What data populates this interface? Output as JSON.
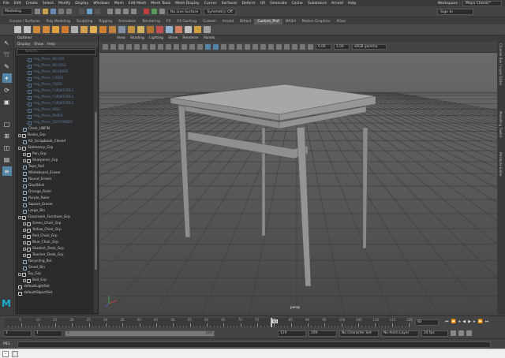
{
  "menubar": {
    "items": [
      "File",
      "Edit",
      "Create",
      "Select",
      "Modify",
      "Display",
      "Windows",
      "Mesh",
      "Edit Mesh",
      "Mesh Tools",
      "Mesh Display",
      "Curves",
      "Surfaces",
      "Deform",
      "UV",
      "Generate",
      "Cache",
      "Substance",
      "Arnold",
      "Help"
    ],
    "workspace_label": "Workspace :",
    "workspace_value": "Maya Classic*"
  },
  "statusline": {
    "mode": "Modeling",
    "live_surface": "No Live Surface",
    "symmetry": "Symmetry: Off",
    "sign_in": "Sign In"
  },
  "shelf": {
    "tabs": [
      "Curves / Surfaces",
      "Poly Modeling",
      "Sculpting",
      "Rigging",
      "Animation",
      "Rendering",
      "FX",
      "FX Caching",
      "Custom",
      "Arnold",
      "Bifrost",
      "Custom_Prof",
      "MASH",
      "Motion Graphics",
      "XGen"
    ],
    "active_tab": "Custom_Prof",
    "icon_colors": [
      "#c0c0c0",
      "#c0c0c0",
      "#d08a3a",
      "#d08a3a",
      "#e0a040",
      "#d07a30",
      "#b0b0b0",
      "#d0a050",
      "#e0b050",
      "#d08030",
      "#c08040",
      "#8090a0",
      "#c09040",
      "#d0b060",
      "#b07030",
      "#c05050",
      "#90b0d0",
      "#d08060",
      "#c0c0c0",
      "#d0a040",
      "#a0a0a0"
    ]
  },
  "toolbox": {
    "tools": [
      "select-tool-icon",
      "lasso-tool-icon",
      "paint-select-icon",
      "move-tool-icon",
      "rotate-tool-icon",
      "scale-tool-icon",
      "last-tool-icon"
    ]
  },
  "outliner": {
    "title": "Outliner",
    "menu": [
      "Display",
      "Show",
      "Help"
    ],
    "search_placeholder": "Search...",
    "items": [
      {
        "label": "img_Plane_BOOKS",
        "indent": 2,
        "dim": true,
        "type": "plane"
      },
      {
        "label": "img_Plane_BOOKS1",
        "indent": 2,
        "dim": true,
        "type": "plane"
      },
      {
        "label": "img_Plane_BOOKPEE",
        "indent": 2,
        "dim": true,
        "type": "plane"
      },
      {
        "label": "img_Plane_CASES",
        "indent": 2,
        "dim": true,
        "type": "plane"
      },
      {
        "label": "img_Plane_FOOD",
        "indent": 2,
        "dim": true,
        "type": "plane"
      },
      {
        "label": "img_Plane_FURNITURE1",
        "indent": 2,
        "dim": true,
        "type": "plane"
      },
      {
        "label": "img_Plane_FURNITURE2",
        "indent": 2,
        "dim": true,
        "type": "plane"
      },
      {
        "label": "img_Plane_FURNITURE3",
        "indent": 2,
        "dim": true,
        "type": "plane"
      },
      {
        "label": "img_Plane_MISC",
        "indent": 2,
        "dim": true,
        "type": "plane"
      },
      {
        "label": "img_Plane_PAPER",
        "indent": 2,
        "dim": true,
        "type": "plane"
      },
      {
        "label": "img_Plane_STATIONERY",
        "indent": 2,
        "dim": true,
        "type": "plane"
      },
      {
        "label": "Clock_UNFIN",
        "indent": 1,
        "dim": false,
        "type": "mesh"
      },
      {
        "label": "Books_Grp",
        "indent": 0,
        "dim": false,
        "type": "group",
        "expand": "+"
      },
      {
        "label": "Kit_Scrapbook_Closed",
        "indent": 1,
        "dim": false,
        "type": "mesh"
      },
      {
        "label": "Stationery_Grp",
        "indent": 0,
        "dim": false,
        "type": "group",
        "expand": "-"
      },
      {
        "label": "Pen_Grp",
        "indent": 1,
        "dim": false,
        "type": "group",
        "expand": "+"
      },
      {
        "label": "Sharpener_Grp",
        "indent": 1,
        "dim": false,
        "type": "group",
        "expand": "+"
      },
      {
        "label": "Tape_Roll",
        "indent": 1,
        "dim": false,
        "type": "mesh"
      },
      {
        "label": "Whiteboard_Eraser",
        "indent": 1,
        "dim": false,
        "type": "mesh"
      },
      {
        "label": "Round_Eraser",
        "indent": 1,
        "dim": false,
        "type": "mesh"
      },
      {
        "label": "GlueStick",
        "indent": 1,
        "dim": false,
        "type": "mesh"
      },
      {
        "label": "Orange_Ruler",
        "indent": 1,
        "dim": false,
        "type": "mesh"
      },
      {
        "label": "Purple_Ruler",
        "indent": 1,
        "dim": false,
        "type": "mesh"
      },
      {
        "label": "Square_Eraser",
        "indent": 1,
        "dim": false,
        "type": "mesh"
      },
      {
        "label": "Large_Bin",
        "indent": 1,
        "dim": false,
        "type": "mesh"
      },
      {
        "label": "Classroom_Furniture_Grp",
        "indent": 0,
        "dim": false,
        "type": "group",
        "expand": "-"
      },
      {
        "label": "Green_Chair_Grp",
        "indent": 1,
        "dim": false,
        "type": "group",
        "expand": "+"
      },
      {
        "label": "Yellow_Chair_Grp",
        "indent": 1,
        "dim": false,
        "type": "group",
        "expand": "+"
      },
      {
        "label": "Red_Chair_Grp",
        "indent": 1,
        "dim": false,
        "type": "group",
        "expand": "+"
      },
      {
        "label": "Blue_Chair_Grp",
        "indent": 1,
        "dim": false,
        "type": "group",
        "expand": "+"
      },
      {
        "label": "Student_Desk_Grp",
        "indent": 1,
        "dim": false,
        "type": "group",
        "expand": "+"
      },
      {
        "label": "Teacher_Desk_Grp",
        "indent": 1,
        "dim": false,
        "type": "group",
        "expand": "+"
      },
      {
        "label": "Recycling_Bin",
        "indent": 1,
        "dim": false,
        "type": "mesh"
      },
      {
        "label": "Small_Bin",
        "indent": 1,
        "dim": false,
        "type": "mesh"
      },
      {
        "label": "Toy_Grp",
        "indent": 0,
        "dim": false,
        "type": "group",
        "expand": "-"
      },
      {
        "label": "Ball_Grp",
        "indent": 1,
        "dim": false,
        "type": "group",
        "expand": "+"
      },
      {
        "label": "defaultLightSet",
        "indent": 0,
        "dim": false,
        "type": "set"
      },
      {
        "label": "defaultObjectSet",
        "indent": 0,
        "dim": false,
        "type": "set"
      }
    ]
  },
  "viewport": {
    "menu": [
      "View",
      "Shading",
      "Lighting",
      "Show",
      "Renderer",
      "Panels"
    ],
    "exposure": "0.00",
    "gamma": "1.00",
    "color_space": "sRGB gamma",
    "camera_label": "persp",
    "right_tabs": [
      "Channel Box / Layer Editor",
      "Modelling Toolkit",
      "Attribute Editor"
    ]
  },
  "timeslider": {
    "ticks": [
      5,
      10,
      15,
      20,
      25,
      30,
      35,
      40,
      45,
      50,
      55,
      60,
      65,
      70,
      75,
      80,
      85,
      90,
      95,
      100,
      105,
      110,
      115,
      120
    ],
    "current_frame": "82",
    "current_frame_fraction": 0.6583
  },
  "rangeslider": {
    "start": "1",
    "start_inner": "1",
    "range_left": "1",
    "range_right": "120",
    "end_inner": "120",
    "end": "200",
    "character_set": "No Character Set",
    "anim_layer": "No Anim Layer",
    "fps": "24 fps"
  },
  "cmdline": {
    "label": "MEL"
  },
  "brand": {
    "logo": "M",
    "logo_color": "#1ab0c9"
  }
}
